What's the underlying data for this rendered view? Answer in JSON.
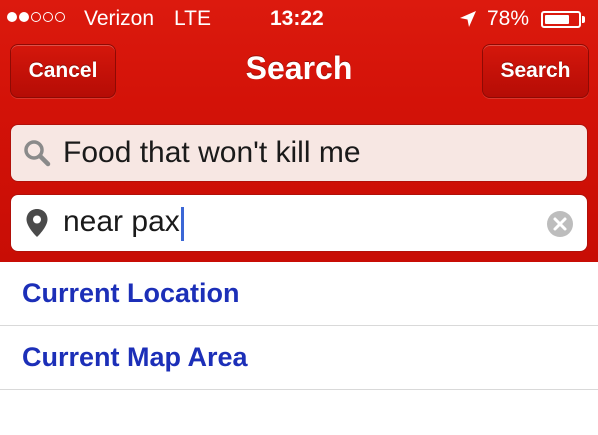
{
  "status_bar": {
    "carrier": "Verizon",
    "network": "LTE",
    "time": "13:22",
    "battery_percent": "78%",
    "battery_level": 0.78,
    "signal_bars": 2,
    "signal_total": 5
  },
  "nav": {
    "cancel_label": "Cancel",
    "title": "Search",
    "search_label": "Search"
  },
  "search": {
    "query_value": "Food that won't kill me",
    "location_value": "near pax"
  },
  "suggestions": [
    {
      "label": "Current Location"
    },
    {
      "label": "Current Map Area"
    }
  ],
  "colors": {
    "header_red": "#d31208",
    "link_blue": "#1c2fb8",
    "caret_blue": "#3b67d6"
  },
  "icons": [
    "location-arrow-icon",
    "battery-icon",
    "search-icon",
    "map-pin-icon",
    "clear-icon"
  ]
}
